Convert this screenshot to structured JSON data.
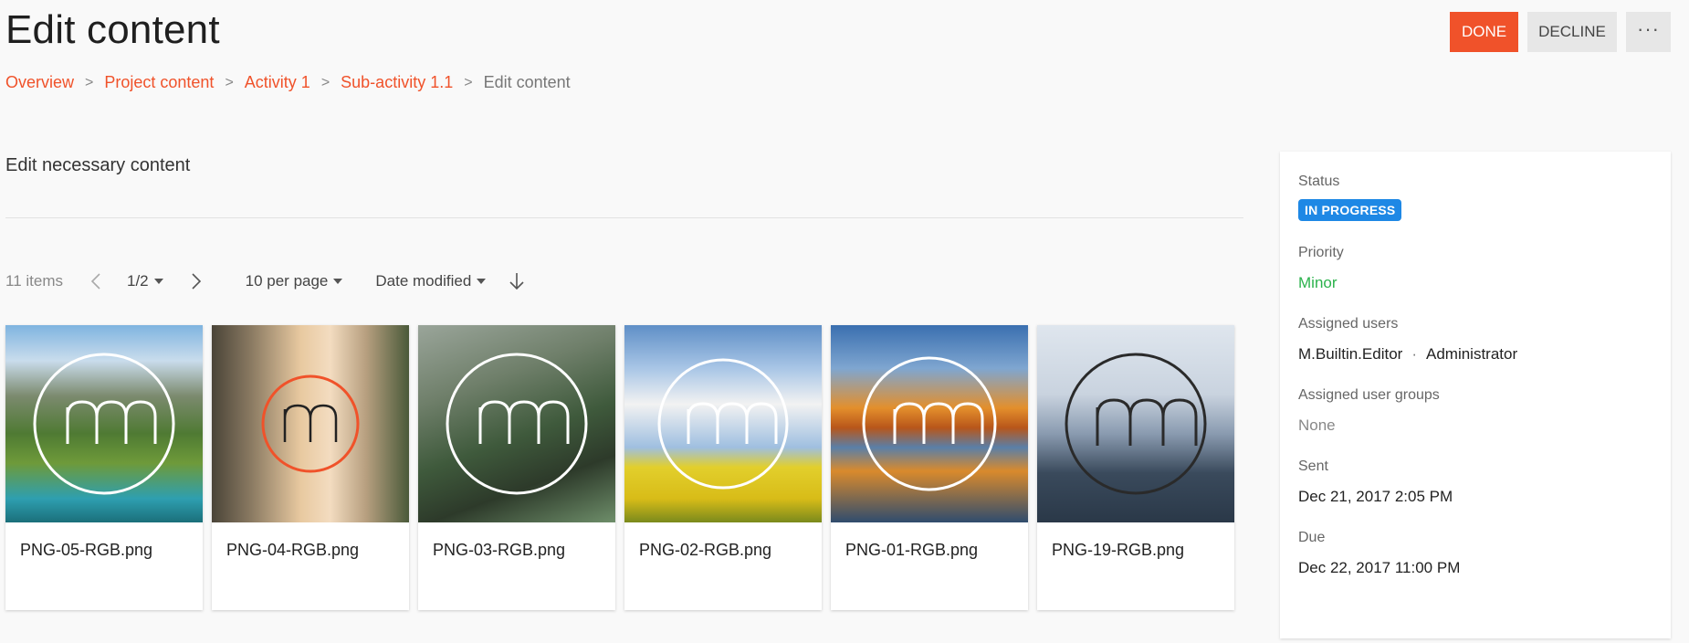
{
  "header": {
    "title": "Edit content",
    "done_label": "DONE",
    "decline_label": "DECLINE",
    "more_label": "···"
  },
  "breadcrumb": {
    "items": [
      "Overview",
      "Project content",
      "Activity 1",
      "Sub-activity 1.1"
    ],
    "current": "Edit content",
    "separator": ">"
  },
  "main": {
    "section_title": "Edit necessary content",
    "toolbar": {
      "items_count": "11 items",
      "page": "1/2",
      "per_page": "10 per page",
      "sort_by": "Date modified",
      "prev_icon": "chevron-left-icon",
      "next_icon": "chevron-right-icon",
      "sort_dir_icon": "arrow-down-icon"
    },
    "cards": [
      {
        "name": "PNG-05-RGB.png",
        "logo_color": "#ffffff"
      },
      {
        "name": "PNG-04-RGB.png",
        "logo_color": "#222222",
        "ring_color": "#f0522a"
      },
      {
        "name": "PNG-03-RGB.png",
        "logo_color": "#ffffff"
      },
      {
        "name": "PNG-02-RGB.png",
        "logo_color": "#ffffff"
      },
      {
        "name": "PNG-01-RGB.png",
        "logo_color": "#ffffff"
      },
      {
        "name": "PNG-19-RGB.png",
        "logo_color": "#2a2a2a"
      }
    ]
  },
  "side_panel": {
    "status": {
      "label": "Status",
      "value": "IN PROGRESS",
      "color": "#1e88e5"
    },
    "priority": {
      "label": "Priority",
      "value": "Minor",
      "color": "#2bb24c"
    },
    "assigned_users": {
      "label": "Assigned users",
      "users": [
        "M.Builtin.Editor",
        "Administrator"
      ]
    },
    "assigned_groups": {
      "label": "Assigned user groups",
      "value": "None"
    },
    "sent": {
      "label": "Sent",
      "value": "Dec 21, 2017 2:05 PM"
    },
    "due": {
      "label": "Due",
      "value": "Dec 22, 2017 11:00 PM"
    }
  },
  "colors": {
    "accent": "#f0522a",
    "status_blue": "#1e88e5",
    "priority_green": "#2bb24c"
  }
}
